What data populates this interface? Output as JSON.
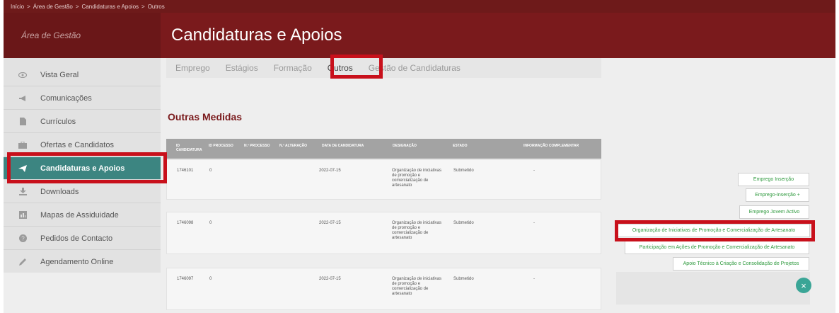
{
  "breadcrumb": [
    "Início",
    ">",
    "Área de Gestão",
    ">",
    "Candidaturas e Apoios",
    ">",
    "Outros"
  ],
  "sidebar": {
    "title": "Área de Gestão",
    "items": [
      {
        "label": "Vista Geral",
        "icon": "eye-icon"
      },
      {
        "label": "Comunicações",
        "icon": "megaphone-icon"
      },
      {
        "label": "Currículos",
        "icon": "document-icon"
      },
      {
        "label": "Ofertas e Candidatos",
        "icon": "briefcase-icon"
      },
      {
        "label": "Candidaturas e Apoios",
        "icon": "send-icon",
        "active": true
      },
      {
        "label": "Downloads",
        "icon": "download-icon"
      },
      {
        "label": "Mapas de Assiduidade",
        "icon": "bar-chart-icon"
      },
      {
        "label": "Pedidos de Contacto",
        "icon": "help-icon"
      },
      {
        "label": "Agendamento Online",
        "icon": "pencil-icon"
      }
    ]
  },
  "header": {
    "title": "Candidaturas e Apoios"
  },
  "tabs": [
    {
      "label": "Emprego"
    },
    {
      "label": "Estágios"
    },
    {
      "label": "Formação"
    },
    {
      "label": "Outros",
      "active": true
    },
    {
      "label": "Gestão de Candidaturas"
    }
  ],
  "main": {
    "section_title": "Outras Medidas",
    "columns": [
      "ID CANDIDATURA",
      "ID PROCESSO",
      "N.º PROCESSO",
      "N.º ALTERAÇÃO",
      "DATA DE CANDIDATURA",
      "DESIGNAÇÃO",
      "ESTADO",
      "INFORMAÇÃO COMPLEMENTAR"
    ],
    "rows": [
      {
        "id": "1746101",
        "processo": "0",
        "data": "2022-07-15",
        "designacao": "Organização de iniciativas de promoção e comercialização de artesanato",
        "estado": "Submetido",
        "info": "-"
      },
      {
        "id": "1746098",
        "processo": "0",
        "data": "2022-07-15",
        "designacao": "Organização de iniciativas de promoção e comercialização de artesanato",
        "estado": "Submetido",
        "info": "-"
      },
      {
        "id": "1746097",
        "processo": "0",
        "data": "2022-07-15",
        "designacao": "Organização de iniciativas de promoção e comercialização de artesanato",
        "estado": "Submetido",
        "info": "-"
      }
    ]
  },
  "menu_options": [
    "Emprego Inserção",
    "Emprego-Inserção +",
    "Emprego Jovem Activo",
    "Organização de Iniciativas de Promoção e Comercialização de Artesanato",
    "Participação em Ações de Promoção e Comercialização de Artesanato",
    "Apoio Técnico à Criação e Consolidação de Projetos"
  ],
  "fab_symbol": "×",
  "colors": {
    "brand_red": "#7a1a1c",
    "highlight_red": "#c8101b",
    "active_teal": "#3c8581",
    "pill_green": "#2f9a3e",
    "fab_teal": "#3aa596"
  }
}
